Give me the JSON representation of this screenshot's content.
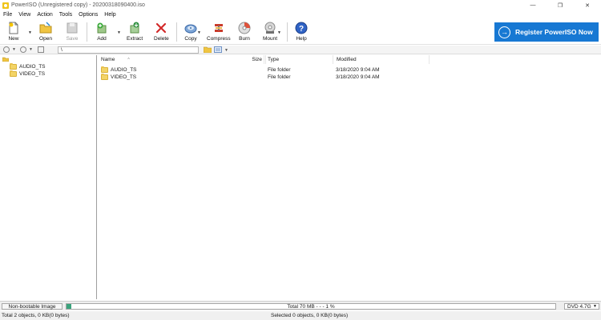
{
  "window": {
    "title": "PowerISO (Unregistered copy) - 20200318090400.iso",
    "minimize": "—",
    "maximize": "❐",
    "close": "✕"
  },
  "menu": [
    "File",
    "View",
    "Action",
    "Tools",
    "Options",
    "Help"
  ],
  "toolbar": {
    "new": "New",
    "open": "Open",
    "save": "Save",
    "add": "Add",
    "extract": "Extract",
    "delete": "Delete",
    "copy": "Copy",
    "compress": "Compress",
    "burn": "Burn",
    "mount": "Mount",
    "help": "Help"
  },
  "register": {
    "label": "Register PowerISO Now",
    "arrow": "→"
  },
  "address": {
    "path": "\\"
  },
  "tree": {
    "items": [
      {
        "label": "AUDIO_TS"
      },
      {
        "label": "VIDEO_TS"
      }
    ]
  },
  "table": {
    "headers": {
      "name": "Name",
      "size": "Size",
      "type": "Type",
      "modified": "Modified"
    },
    "rows": [
      {
        "name": "AUDIO_TS",
        "size": "",
        "type": "File folder",
        "modified": "3/18/2020 9:04 AM"
      },
      {
        "name": "VIDEO_TS",
        "size": "",
        "type": "File folder",
        "modified": "3/18/2020 9:04 AM"
      }
    ]
  },
  "status": {
    "boot": "Non-bootable Image",
    "capacity_text": "Total  70 MB   - - -  1 %",
    "capacity_percent": 1,
    "disc_type": "DVD 4.7G",
    "left": "Total 2 objects, 0 KB(0 bytes)",
    "right": "Selected 0 objects, 0 KB(0 bytes)"
  },
  "colors": {
    "register_bg": "#1778d3",
    "capacity_fill": "#3aa37c",
    "folder": "#f3d467"
  }
}
